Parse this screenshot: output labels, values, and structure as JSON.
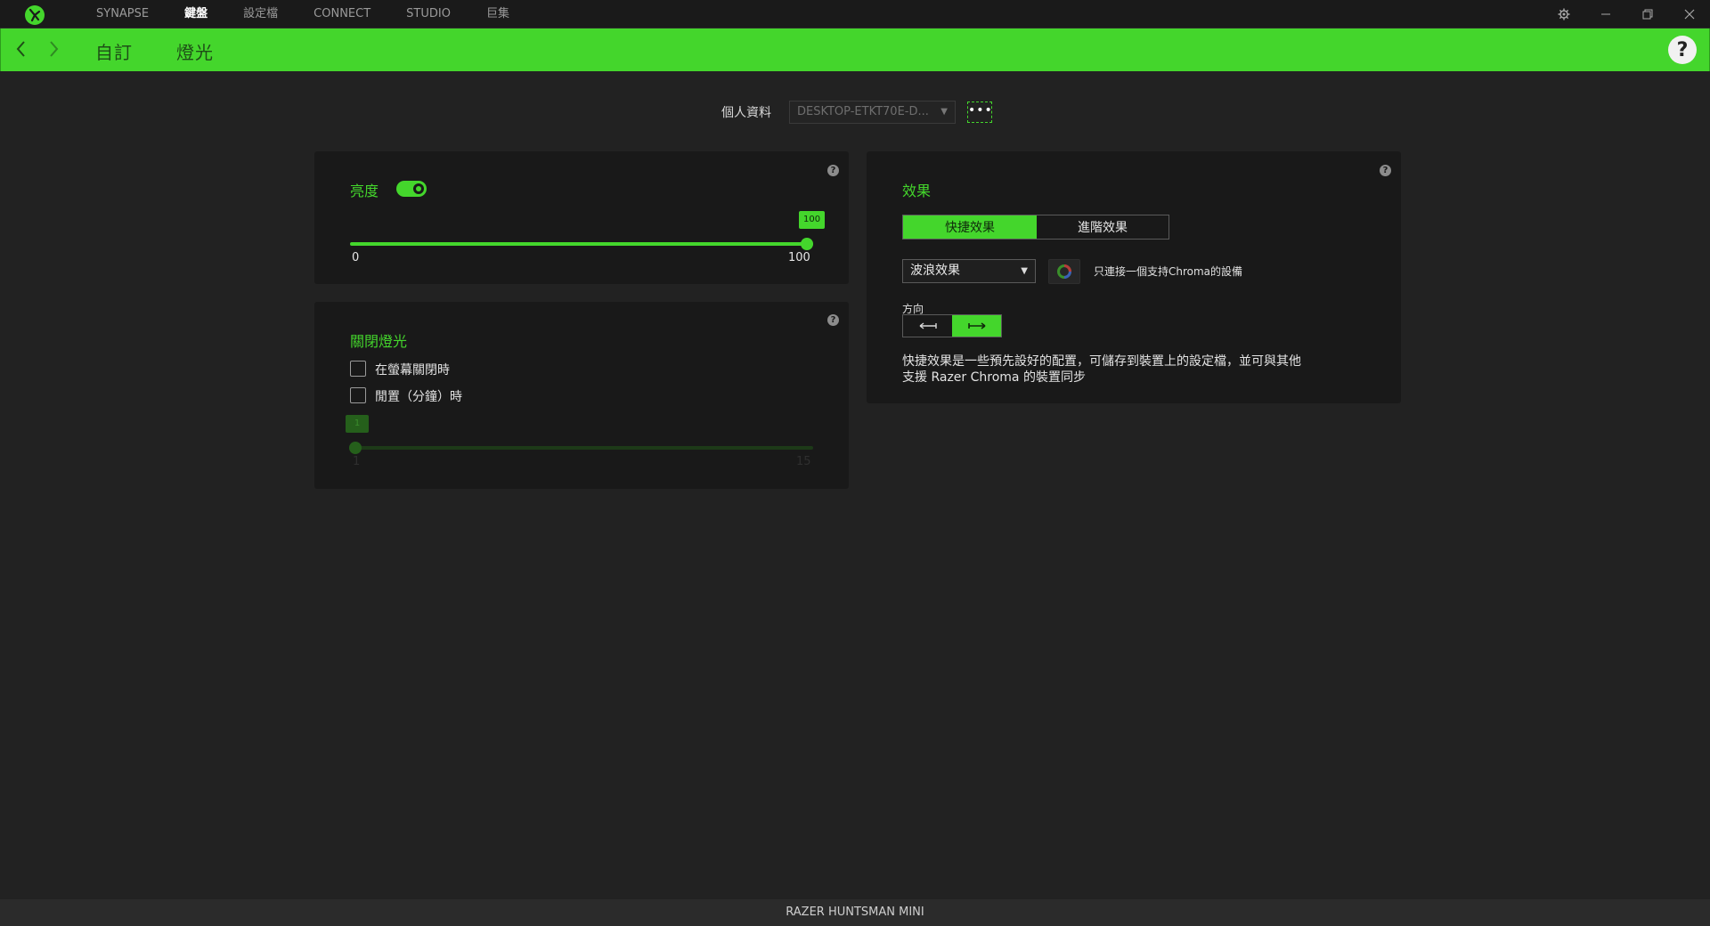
{
  "app": {
    "nav_tabs": [
      {
        "label": "SYNAPSE",
        "active": false
      },
      {
        "label": "鍵盤",
        "active": true
      },
      {
        "label": "設定檔",
        "active": false
      },
      {
        "label": "CONNECT",
        "active": false
      },
      {
        "label": "STUDIO",
        "active": false
      },
      {
        "label": "巨集",
        "active": false
      }
    ],
    "accent_color": "#44d62c"
  },
  "subheader": {
    "crumbs": [
      "自訂",
      "燈光"
    ],
    "help_symbol": "?"
  },
  "profile": {
    "label": "個人資料",
    "value": "DESKTOP-ETKT70E-D...",
    "more_symbol": "•••"
  },
  "brightness": {
    "title": "亮度",
    "enabled": true,
    "value": 100,
    "value_label": "100",
    "min_label": "0",
    "max_label": "100",
    "min": 0,
    "max": 100
  },
  "lights_off": {
    "title": "關閉燈光",
    "options": [
      {
        "label": "在螢幕關閉時",
        "checked": false
      },
      {
        "label": "閒置（分鐘）時",
        "checked": false
      }
    ],
    "idle_value": 1,
    "idle_value_label": "1",
    "idle_min_label": "1",
    "idle_max_label": "15",
    "idle_min": 1,
    "idle_max": 15
  },
  "effects": {
    "title": "效果",
    "tabs": [
      {
        "label": "快捷效果",
        "selected": true
      },
      {
        "label": "進階效果",
        "selected": false
      }
    ],
    "selected_effect": "波浪效果",
    "chroma_note": "只連接一個支持Chroma的設備",
    "direction_label": "方向",
    "direction_options": [
      {
        "icon": "arrow-left-icon",
        "selected": false
      },
      {
        "icon": "arrow-right-icon",
        "selected": true
      }
    ],
    "description_line1": "快捷效果是一些預先設好的配置，可儲存到裝置上的設定檔，並可與其他",
    "description_line2": "支援 Razer Chroma 的裝置同步"
  },
  "footer": {
    "device_name": "RAZER HUNTSMAN MINI"
  }
}
